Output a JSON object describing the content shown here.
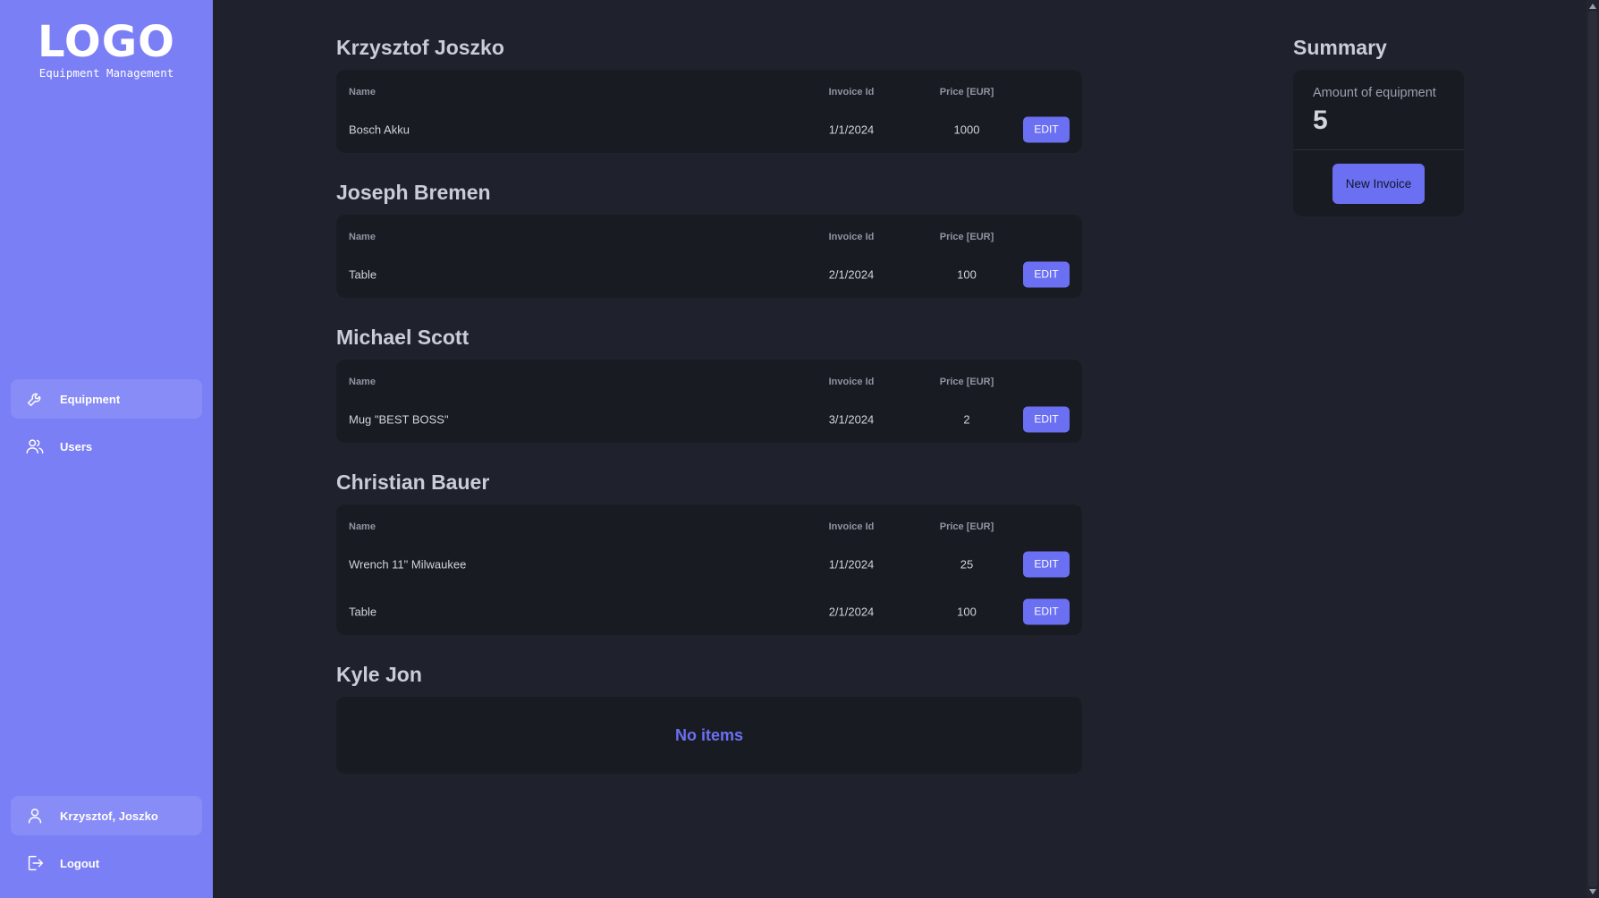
{
  "sidebar": {
    "logo": "LOGO",
    "subtitle": "Equipment Management",
    "nav": [
      {
        "label": "Equipment",
        "icon": "wrench-icon",
        "active": true
      },
      {
        "label": "Users",
        "icon": "users-icon",
        "active": false
      }
    ],
    "user": {
      "label": "Krzysztof, Joszko",
      "icon": "user-icon"
    },
    "logout": {
      "label": "Logout",
      "icon": "logout-icon"
    }
  },
  "columns": {
    "name": "Name",
    "invoice": "Invoice Id",
    "price": "Price [EUR]"
  },
  "edit_label": "EDIT",
  "groups": [
    {
      "owner": "Krzysztof Joszko",
      "items": [
        {
          "name": "Bosch Akku",
          "invoice": "1/1/2024",
          "price": "1000"
        }
      ]
    },
    {
      "owner": "Joseph Bremen",
      "items": [
        {
          "name": "Table",
          "invoice": "2/1/2024",
          "price": "100"
        }
      ]
    },
    {
      "owner": "Michael Scott",
      "items": [
        {
          "name": "Mug \"BEST BOSS\"",
          "invoice": "3/1/2024",
          "price": "2"
        }
      ]
    },
    {
      "owner": "Christian Bauer",
      "items": [
        {
          "name": "Wrench 11\" Milwaukee",
          "invoice": "1/1/2024",
          "price": "25"
        },
        {
          "name": "Table",
          "invoice": "2/1/2024",
          "price": "100"
        }
      ]
    },
    {
      "owner": "Kyle Jon",
      "items": [],
      "empty_label": "No items"
    }
  ],
  "summary": {
    "title": "Summary",
    "label": "Amount of equipment",
    "value": "5",
    "button": "New Invoice"
  },
  "colors": {
    "sidebar": "#7b7ff6",
    "accent": "#6b70f2",
    "background": "#1f222d",
    "card": "#191b22"
  }
}
